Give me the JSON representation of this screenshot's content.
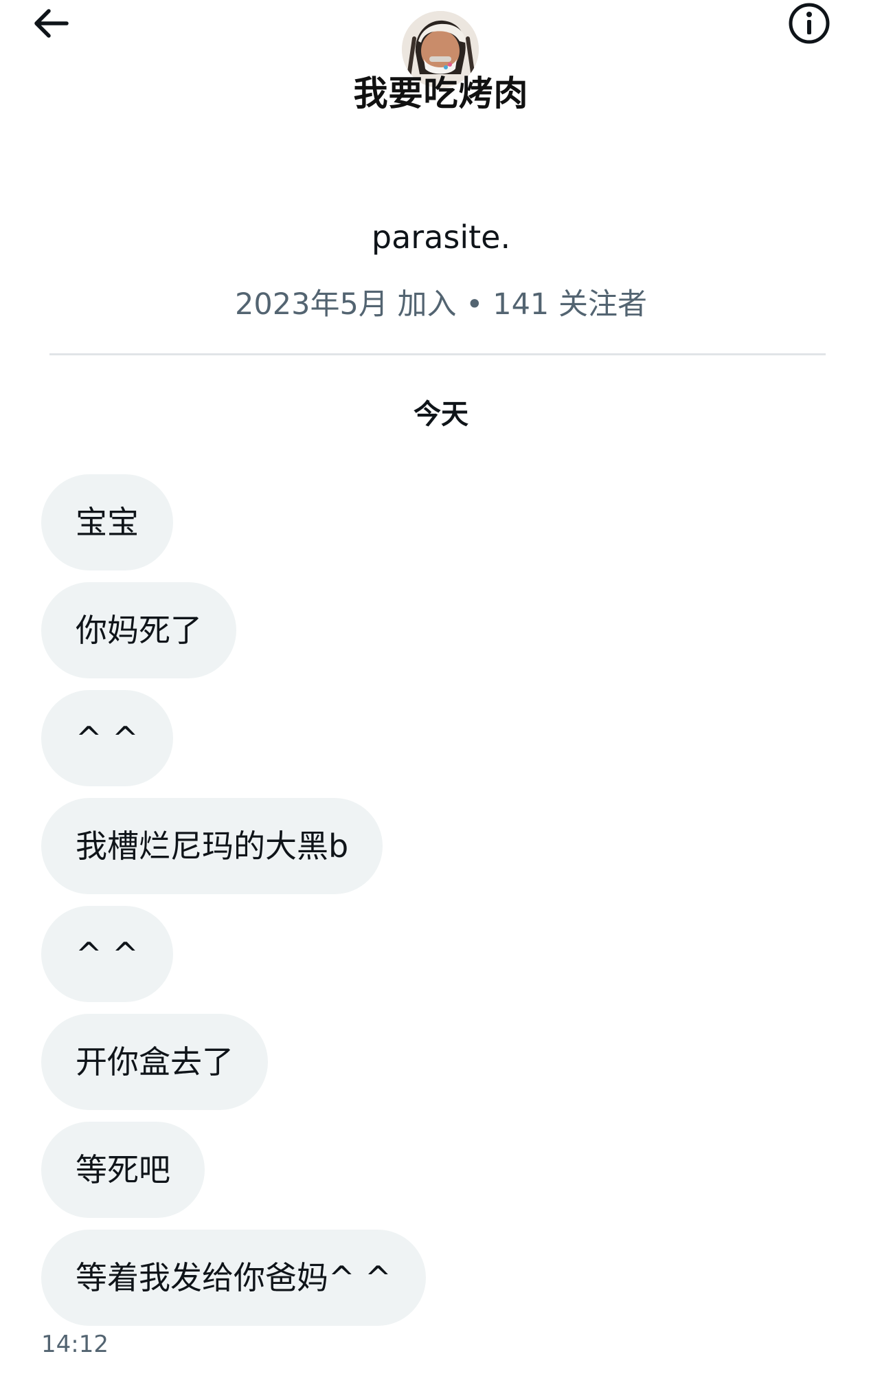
{
  "header": {
    "title": "我要吃烤肉",
    "back_icon": "arrow-left-icon",
    "info_icon": "info-circle-icon"
  },
  "profile": {
    "name": "parasite.",
    "meta": "2023年5月 加入 • 141 关注者"
  },
  "conversation": {
    "day_label": "今天",
    "messages": [
      {
        "text": "宝宝"
      },
      {
        "text": "你妈死了"
      },
      {
        "text": "^ ^"
      },
      {
        "text": "我槽烂尼玛的大黑b"
      },
      {
        "text": "^ ^"
      },
      {
        "text": "开你盒去了"
      },
      {
        "text": "等死吧"
      },
      {
        "text": "等着我发给你爸妈^ ^"
      }
    ],
    "last_timestamp": "14:12"
  },
  "colors": {
    "bubble_bg": "#eff3f4",
    "text_primary": "#0f1419",
    "text_secondary": "#536471",
    "divider": "#e1e4e7"
  }
}
